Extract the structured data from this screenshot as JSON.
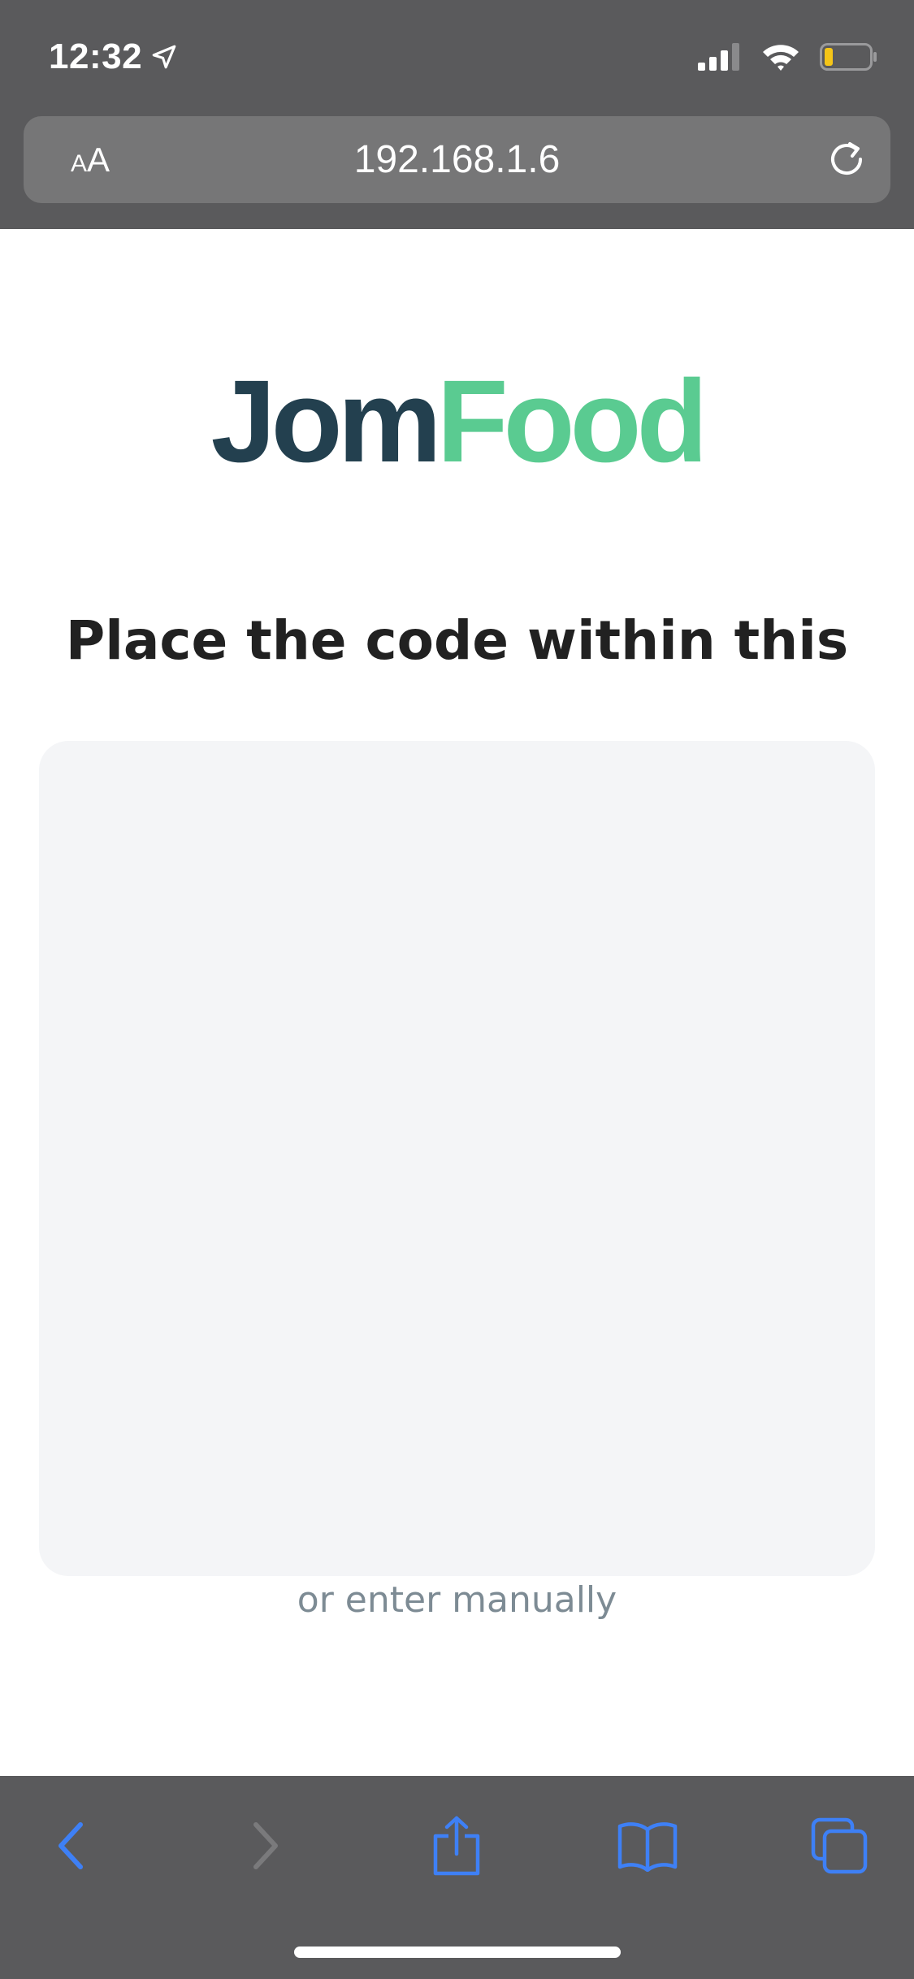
{
  "status_bar": {
    "time": "12:32",
    "icons": [
      "location-arrow-icon",
      "cellular-signal-icon",
      "wifi-icon",
      "battery-low-icon"
    ],
    "battery_color": "#f5c518"
  },
  "browser": {
    "text_size_small": "A",
    "text_size_large": "A",
    "url": "192.168.1.6",
    "toolbar_icons": [
      "back-icon",
      "forward-icon",
      "share-icon",
      "bookmarks-icon",
      "tabs-icon"
    ],
    "accent_color": "#3e80f6"
  },
  "page": {
    "logo": {
      "part1": "Jom",
      "part2": "Food",
      "part1_color": "#23404f",
      "part2_color": "#5acb91"
    },
    "heading": "Place the code within this",
    "manual_link": "or enter manually"
  }
}
